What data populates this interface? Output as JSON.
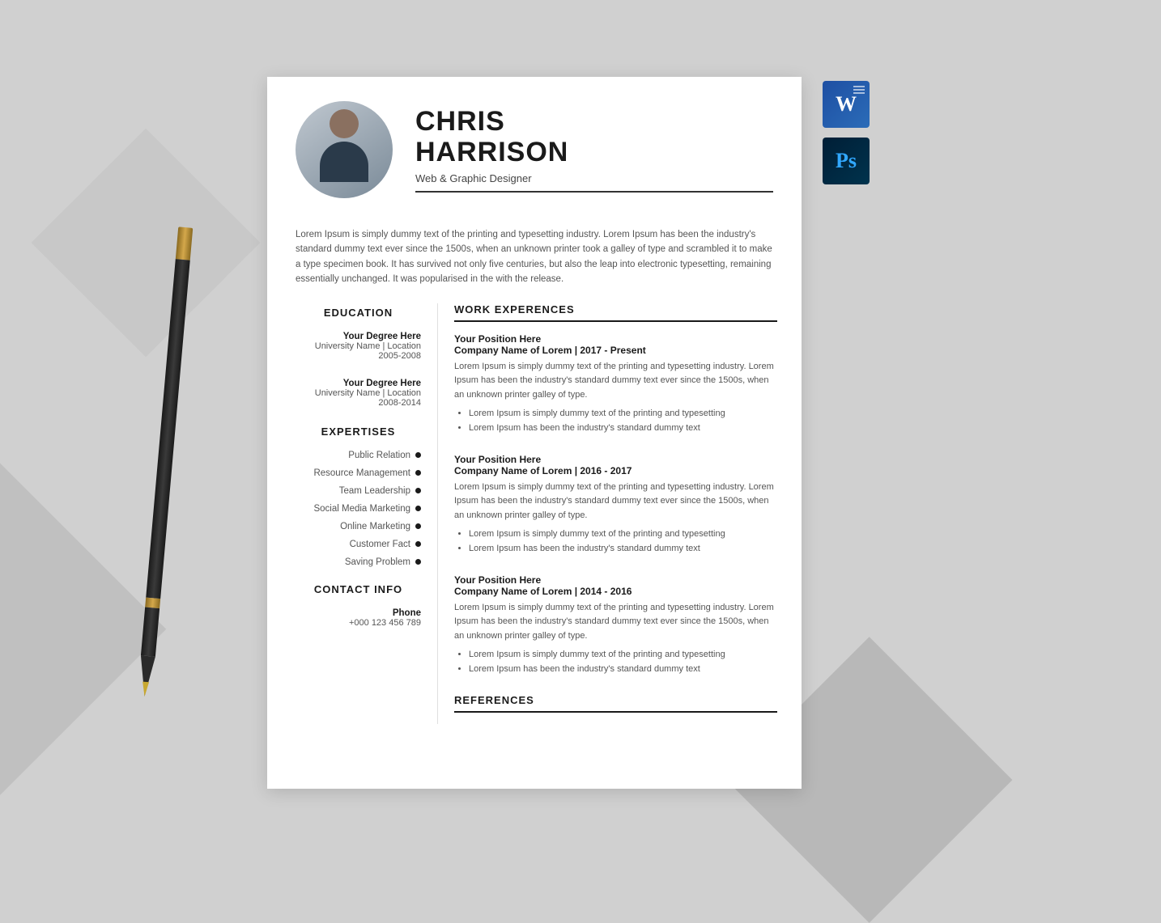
{
  "page": {
    "background_color": "#d0d0d0"
  },
  "app_icons": {
    "word": {
      "label": "W",
      "subtitle": "doc lines"
    },
    "photoshop": {
      "label": "Ps"
    }
  },
  "resume": {
    "name_first": "CHRIS",
    "name_last": "HARRISON",
    "job_title": "Web & Graphic Designer",
    "summary": "Lorem Ipsum is simply dummy text of the printing and typesetting industry. Lorem Ipsum has been the industry's standard dummy text ever since the 1500s, when an unknown printer took a galley of type and scrambled it to make a type specimen book. It has survived not only five centuries, but also the leap into electronic typesetting, remaining essentially unchanged. It was popularised in the with the release.",
    "education": {
      "section_title": "EDUCATION",
      "entries": [
        {
          "degree": "Your Degree Here",
          "school": "University Name | Location",
          "years": "2005-2008"
        },
        {
          "degree": "Your Degree Here",
          "school": "University Name | Location",
          "years": "2008-2014"
        }
      ]
    },
    "expertises": {
      "section_title": "EXPERTISES",
      "items": [
        "Public Relation",
        "Resource Management",
        "Team Leadership",
        "Social Media Marketing",
        "Online Marketing",
        "Customer Fact",
        "Saving Problem"
      ]
    },
    "contact": {
      "section_title": "CONTACT INFO",
      "phone_label": "Phone",
      "phone_value": "+000 123 456 789"
    },
    "work": {
      "section_title": "WORK EXPERENCES",
      "dummy_desc": "Lorem Ipsum is simply dummy text of the printing and typesetting industry. Lorem Ipsum has been the industry's standard dummy text ever since the 1500s, when an unknown printer galley of type.",
      "bullet1": "Lorem Ipsum is simply dummy text of the printing and typesetting",
      "bullet2": "Lorem Ipsum has been the industry's standard dummy text",
      "entries": [
        {
          "position": "Your Position Here",
          "company": "Company Name of Lorem | 2017 - Present"
        },
        {
          "position": "Your Position Here",
          "company": "Company Name of Lorem | 2016 - 2017"
        },
        {
          "position": "Your Position Here",
          "company": "Company Name of Lorem | 2014 - 2016"
        }
      ]
    },
    "references": {
      "section_title": "REFERENCES"
    }
  }
}
